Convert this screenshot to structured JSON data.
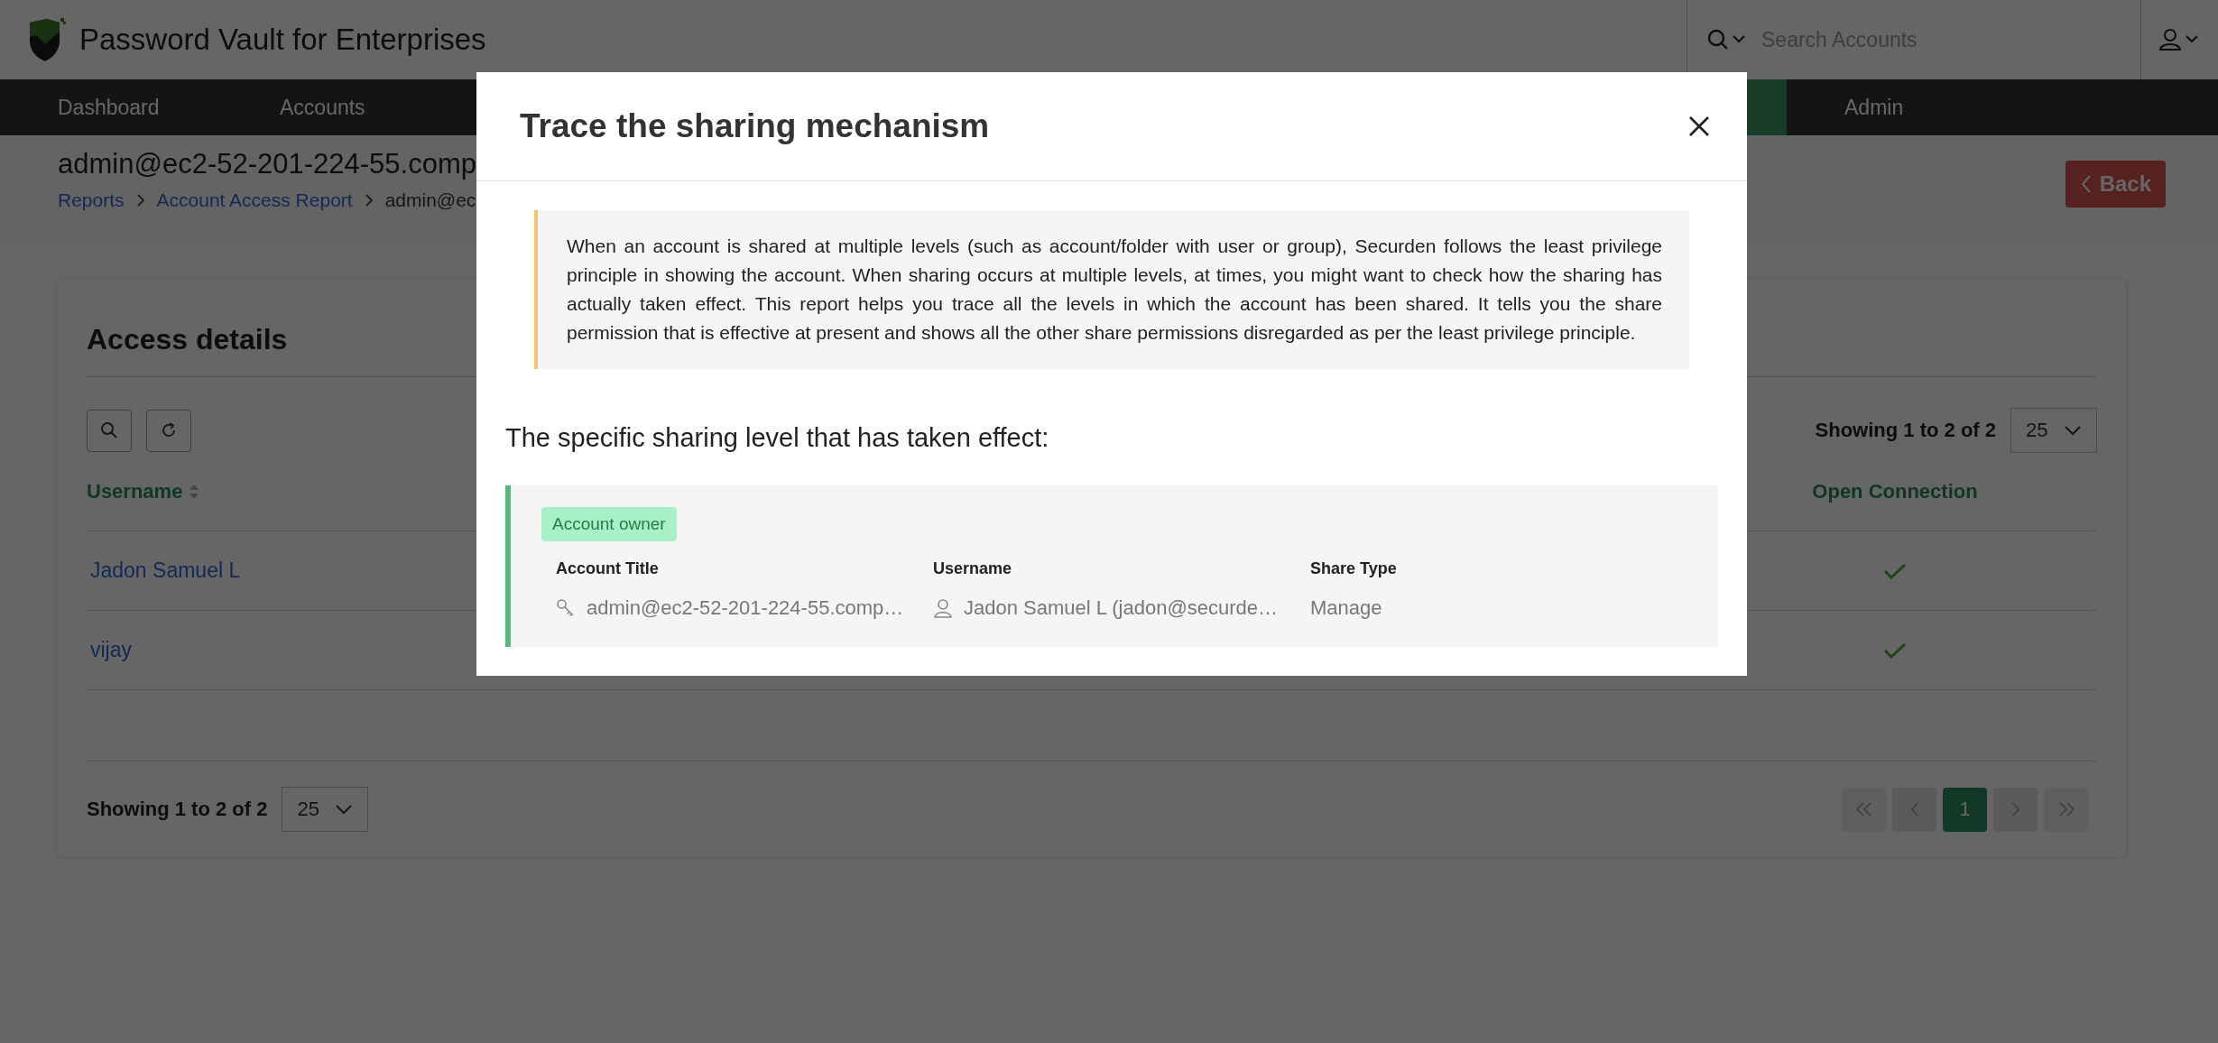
{
  "app": {
    "title": "Password Vault for Enterprises"
  },
  "search": {
    "placeholder": "Search Accounts"
  },
  "nav": [
    {
      "label": "Dashboard",
      "selected": false
    },
    {
      "label": "Accounts",
      "selected": false
    },
    {
      "selected": true
    },
    {
      "label": "Admin",
      "selected": false
    }
  ],
  "page": {
    "title": "admin@ec2-52-201-224-55.comp",
    "back_button": "Back",
    "breadcrumb": [
      {
        "label": "Reports"
      },
      {
        "label": "Account Access Report"
      },
      {
        "label": "admin@ec"
      }
    ]
  },
  "access_details": {
    "title": "Access details",
    "top_pager": {
      "summary": "Showing 1 to 2 of 2",
      "page_size": "25"
    },
    "columns": [
      "Username",
      "Open Connection"
    ],
    "rows": [
      {
        "username": "Jadon Samuel L",
        "open_connection": true
      },
      {
        "username": "vijay",
        "open_connection": true
      }
    ],
    "bottom_pager": {
      "summary": "Showing 1 to 2 of 2",
      "page_size": "25"
    },
    "pages": [
      {
        "label": "1",
        "selected": true
      }
    ]
  },
  "dialog": {
    "title": "Trace the sharing mechanism",
    "note": "When an account is shared at multiple levels (such as account/folder with user or group), Securden follows the least privilege principle in showing the account. When sharing occurs at multiple levels, at times, you might want to check how the sharing has actually taken effect. This report helps you trace all the levels in which the account has been shared. It tells you the share permission that is effective at present and shows all the other share permissions disregarded as per the least privilege principle.",
    "section_heading": "The specific sharing level that has taken effect:",
    "effective_share": {
      "badge": "Account owner",
      "columns": [
        {
          "heading": "Account Title",
          "value": "admin@ec2-52-201-224-55.comp…",
          "kind": "key"
        },
        {
          "heading": "Username",
          "value": "Jadon Samuel L (jadon@securde…",
          "kind": "user"
        },
        {
          "heading": "Share Type",
          "value": "Manage",
          "kind": "plain"
        }
      ]
    }
  }
}
